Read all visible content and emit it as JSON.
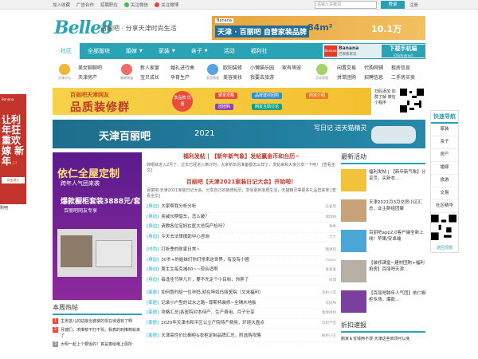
{
  "topbar": {
    "links": [
      "加入收藏",
      "广告合作",
      "招聘职位",
      "关注微信",
      "关注微博"
    ],
    "search_placeholder": "请输入关键词",
    "login": "登录",
    "register": "注册"
  },
  "brand": {
    "logo": "Belle8",
    "slogan": "百丽吧 · 分享天津时尚生活"
  },
  "header_ad": {
    "brand": "Banana",
    "tagline": "天津 · 百丽吧\n自营家装品牌",
    "area": "84m²",
    "price": "10.1万"
  },
  "nav": {
    "items": [
      "社区",
      "全部版块",
      "婚嫁",
      "家装",
      "亲子",
      "活动",
      "福利社"
    ],
    "app_ad": {
      "brand": "Banana",
      "name": "巴那那家装",
      "sub": "下载手机端",
      "sub2": "iOS/Android"
    }
  },
  "subnav": {
    "groups": [
      {
        "caption": "天津论坛",
        "links": [
          "美女聊聊吧",
          "天津房产"
        ]
      },
      {
        "caption": "婚嫁频道",
        "links": [
          "新人家宴",
          "婚礼进行曲",
          "宝贝成长",
          "孕育生产"
        ]
      },
      {
        "caption": "家居频道",
        "links": [
          "欧阳装修",
          "小懒猫乐园",
          "家有萌宠",
          "美容美妆",
          "我要去旅游"
        ]
      },
      {
        "caption": "活动频道",
        "links": [
          "闲置交易",
          "代购网铺",
          "租房信息",
          "拼单团购",
          "招聘信息",
          "二手房买卖"
        ]
      }
    ]
  },
  "banner1": {
    "title": "百丽吧天津网友",
    "headline": "品质装修群",
    "badge": "享品牌 优惠",
    "pills": [
      "聚家攻略",
      "品牌建材团购",
      "商家介绍",
      "团团购",
      "网友互助讨论"
    ],
    "qr_text": "扫码添加 加群了解 微信小程序"
  },
  "banner2": {
    "title": "天津百丽吧",
    "year": "2021",
    "text": "写日记 送天猫精灵"
  },
  "left_ad": {
    "title": "依仁全屋定制",
    "subtitle": "跨年人气团来袭",
    "price_label": "爆款橱柜套装3888元/套",
    "promo": "百丽吧网友专享"
  },
  "hot": {
    "title": "本周热帖",
    "items": [
      "生男孩儿的姑娘当婆婆的现在待遇有了啊",
      "月嫂们，求推荐不打不骂，我真的到推荐就来了",
      "大明一起上个要饭的！真是奏给哦上厕所"
    ]
  },
  "news": {
    "headline": "福利发帖 | 【新年新气象】发帖赢金币和台历~",
    "summary": "转眼就进入2月了，过年已经进入倒计时，大家新年的准备都怎么样了，发帖来和大家分享一下吧！ [查看全文]",
    "headline2": "百丽吧【天津2021家装日记大会】开始啦！",
    "summary2": "百丽吧·天津2021家装日记大会，分享自己的装修经历，享受更新家居生活，天猫精灵等更多礼品您来拿 [查看全文]",
    "items": [
      {
        "cat": "[身边]",
        "title": "大家帮我分析分析",
        "author": "云雀风"
      },
      {
        "cat": "[身边]",
        "title": "亲戚长期借车，怎么破？",
        "author": "瑞瑞呢"
      },
      {
        "cat": "[身边]",
        "title": "请教各位宝妈在医大总院产检吗？",
        "author": "乖乖"
      },
      {
        "cat": "[身边]",
        "title": "今天去法律援助中心咨询",
        "author": "大大"
      },
      {
        "cat": "[时尚]",
        "title": "打折季的败家日常~",
        "author": "糖果风"
      },
      {
        "cat": "[身边]",
        "title": "30岁+的姐妹们你们常来这世界，有没有小圈",
        "author": "hamu"
      },
      {
        "cat": "[身边]",
        "title": "周生生每克减60~~现合适啊",
        "author": "爱爱爱"
      },
      {
        "cat": "[身边]",
        "title": "每逢佳节胖几斤，要不先定个小目标，你胖了",
        "author": "玫瑰"
      },
      {
        "cat": "[家居]",
        "title": "如何暂时给一位孕妈,就在坤如玛丽医院（文末福利）",
        "author": "孕妈小李"
      },
      {
        "cat": "[家居]",
        "title": "记录小户型的试水之路~尊斯特装修~全铺木地板",
        "author": "孕妈咪"
      },
      {
        "cat": "[家居]",
        "title": "攻略汇总|各医院对本待产、生产费用、月子分享",
        "author": "金牌律师"
      },
      {
        "cat": "[家居]",
        "title": "2020年天津市和平区公立产院待产费用，环境大盘点",
        "author": "孕妈学堂"
      },
      {
        "cat": "[家居]",
        "title": "天津高性价比橱柜&衣柜定制品牌汇总，附选购攻略",
        "author": "橱柜小王"
      }
    ]
  },
  "right": {
    "title": "最新活动",
    "entries": [
      "福利发帖 | 【新年新气象】分享页，买新衣...",
      "天津2021月3月交房小区汇总，业主群组团聚",
      "百丽吧app2.0客户端全新上线！苹果/安卓端",
      "【装修课堂~建材团购+福利抢房】百丽吧天津...",
      "【百丽吧跨年人气团】依仁橱柜专场，爆款..."
    ],
    "title2": "折扣速报",
    "quick_link": "鹅家＆省钱两不误 天津这些商场可以免"
  },
  "quick": {
    "title": "快速导航",
    "items": [
      "家装",
      "亲子",
      "房产",
      "婚嫁",
      "旅游",
      "交易",
      "社区精华"
    ],
    "back": "返回顶部"
  },
  "side_ad": {
    "brand": "Banana",
    "text": "让利年狂重欢嫁 新年",
    "date": "1.16-1.17",
    "btn": "点击进入"
  },
  "side_caption": "购吧"
}
